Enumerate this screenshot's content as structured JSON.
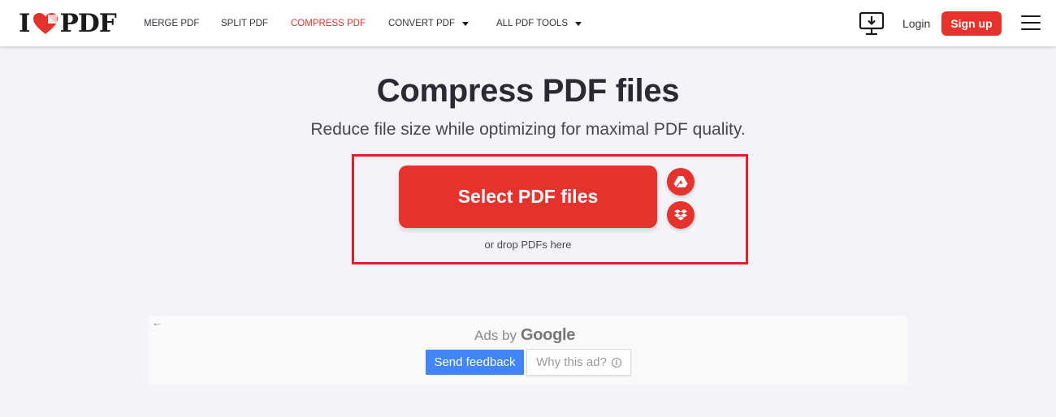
{
  "header": {
    "logo": {
      "prefix": "I",
      "suffix": "PDF",
      "icon": "heart-icon"
    },
    "nav": [
      {
        "label": "MERGE PDF",
        "active": false,
        "dropdown": false
      },
      {
        "label": "SPLIT PDF",
        "active": false,
        "dropdown": false
      },
      {
        "label": "COMPRESS PDF",
        "active": true,
        "dropdown": false
      },
      {
        "label": "CONVERT PDF",
        "active": false,
        "dropdown": true
      },
      {
        "label": "ALL PDF TOOLS",
        "active": false,
        "dropdown": true
      }
    ],
    "desktop_icon": "desktop-download-icon",
    "login_label": "Login",
    "signup_label": "Sign up",
    "menu_icon": "hamburger-menu-icon"
  },
  "main": {
    "title": "Compress PDF files",
    "subtitle": "Reduce file size while optimizing for maximal PDF quality.",
    "select_button_label": "Select PDF files",
    "drop_hint": "or drop PDFs here",
    "cloud_sources": [
      {
        "name": "Google Drive",
        "icon": "google-drive-icon"
      },
      {
        "name": "Dropbox",
        "icon": "dropbox-icon"
      }
    ]
  },
  "ad": {
    "back_icon": "←",
    "ads_by": "Ads by",
    "google": "Google",
    "send_feedback": "Send feedback",
    "why_this_ad": "Why this ad?",
    "info_glyph": "i"
  },
  "colors": {
    "brand_red": "#e5322d",
    "highlight_border": "#e0202a",
    "feedback_blue": "#4285f4",
    "page_bg": "#f4f4f8"
  }
}
